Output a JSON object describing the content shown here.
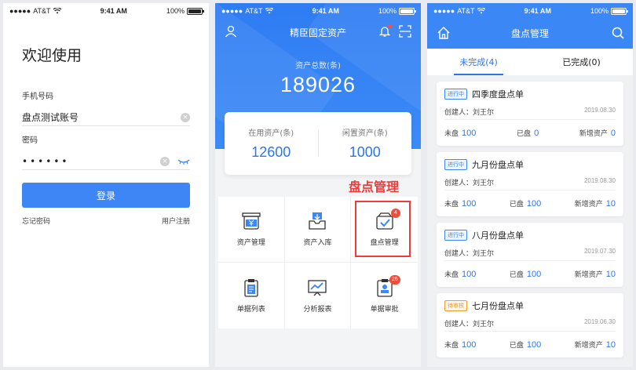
{
  "status_bar": {
    "carrier": "AT&T",
    "time": "9:41 AM",
    "battery": "100%"
  },
  "login": {
    "title": "欢迎使用",
    "phone_label": "手机号码",
    "phone_value": "盘点测试账号",
    "password_label": "密码",
    "password_value": "••••••",
    "login_button": "登录",
    "forgot_link": "忘记密码",
    "register_link": "用户注册"
  },
  "home": {
    "title": "精臣固定资产",
    "total_label": "资产总数(条)",
    "total_value": "189026",
    "in_use_label": "在用资产(条)",
    "in_use_value": "12600",
    "idle_label": "闲置资产(条)",
    "idle_value": "1000",
    "callout": "盘点管理",
    "menu": [
      {
        "label": "资产管理",
        "icon": "yen-box-icon"
      },
      {
        "label": "资产入库",
        "icon": "inbox-download-icon"
      },
      {
        "label": "盘点管理",
        "icon": "check-box-icon",
        "badge": "4"
      },
      {
        "label": "单据列表",
        "icon": "clipboard-list-icon"
      },
      {
        "label": "分析报表",
        "icon": "chart-board-icon"
      },
      {
        "label": "单据审批",
        "icon": "approval-stamp-icon",
        "badge": "26"
      }
    ]
  },
  "inventory": {
    "title": "盘点管理",
    "tabs": [
      "未完成(4)",
      "已完成(0)"
    ],
    "labels": {
      "creator": "创建人：",
      "unchecked": "未盘",
      "checked": "已盘",
      "added": "新增资产"
    },
    "cards": [
      {
        "status": "进行中",
        "title": "四季度盘点单",
        "creator": "刘王尔",
        "date": "2019.08.30",
        "unchecked": "100",
        "checked": "0",
        "added": "0"
      },
      {
        "status": "进行中",
        "title": "九月份盘点单",
        "creator": "刘王尔",
        "date": "2019.08.30",
        "unchecked": "100",
        "checked": "100",
        "added": "10"
      },
      {
        "status": "进行中",
        "title": "八月份盘点单",
        "creator": "刘王尔",
        "date": "2019.07.30",
        "unchecked": "100",
        "checked": "100",
        "added": "10"
      },
      {
        "status": "待审核",
        "title": "七月份盘点单",
        "creator": "刘王尔",
        "date": "2019.06.30",
        "unchecked": "100",
        "checked": "100",
        "added": "10"
      }
    ]
  },
  "colors": {
    "primary": "#3b87f5",
    "accent_red": "#ee3b3b",
    "value_blue": "#2e75e8",
    "pending_orange": "#f29a2e"
  }
}
